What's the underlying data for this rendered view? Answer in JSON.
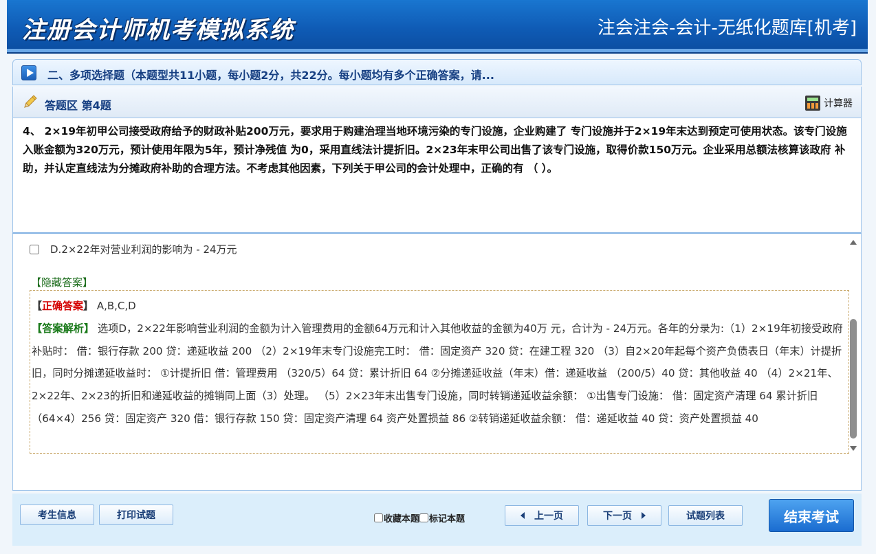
{
  "header": {
    "app_title": "注册会计师机考模拟系统",
    "subtitle": "注会注会-会计-无纸化题库[机考]"
  },
  "section": {
    "title": "二、多项选择题（本题型共11小题，每小题2分，共22分。每小题均有多个正确答案，请..."
  },
  "answer_area": {
    "title": "答题区 第4题",
    "calculator_label": "计算器"
  },
  "question": {
    "text": "4、 2×19年初甲公司接受政府给予的财政补贴200万元，要求用于购建治理当地环境污染的专门设施，企业购建了 专门设施并于2×19年末达到预定可使用状态。该专门设施入账金额为320万元，预计使用年限为5年，预计净残值 为0，采用直线法计提折旧。2×23年末甲公司出售了该专门设施，取得价款150万元。企业采用总额法核算该政府 补助，并认定直线法为分摊政府补助的合理方法。不考虑其他因素，下列关于甲公司的会计处理中，正确的有 （ ）。"
  },
  "options": [
    {
      "label": "D.2×22年对营业利润的影响为 - 24万元",
      "checked": false
    }
  ],
  "answer": {
    "hide_link": "【隐藏答案】",
    "correct_label": "正确答案",
    "correct_value": "A,B,C,D",
    "analysis_label": "答案解析",
    "analysis_text": "选项D，2×22年影响营业利润的金额为计入管理费用的金额64万元和计入其他收益的金额为40万 元，合计为 - 24万元。各年的分录为:（1）2×19年初接受政府补贴时： 借：银行存款 200 贷：递延收益 200 （2）2×19年末专门设施完工时： 借：固定资产 320 贷：在建工程 320 （3）自2×20年起每个资产负债表日（年末）计提折旧，同时分摊递延收益时： ①计提折旧 借：管理费用 （320/5）64 贷：累计折旧 64 ②分摊递延收益（年末）借：递延收益 （200/5）40 贷：其他收益 40 （4）2×21年、2×22年、2×23的折旧和递延收益的摊销同上面（3）处理。 （5）2×23年末出售专门设施，同时转销递延收益余额： ①出售专门设施： 借：固定资产清理 64 累计折旧 （64×4）256 贷：固定资产 320 借：银行存款 150 贷：固定资产清理 64 资产处置损益 86 ②转销递延收益余额： 借：递延收益 40 贷：资产处置损益 40"
  },
  "footer": {
    "candidate_info": "考生信息",
    "print_paper": "打印试题",
    "favorite_label": "收藏本题",
    "mark_label": "标记本题",
    "prev_label": "上一页",
    "next_label": "下一页",
    "list_label": "试题列表",
    "end_exam_label": "结束考试"
  }
}
